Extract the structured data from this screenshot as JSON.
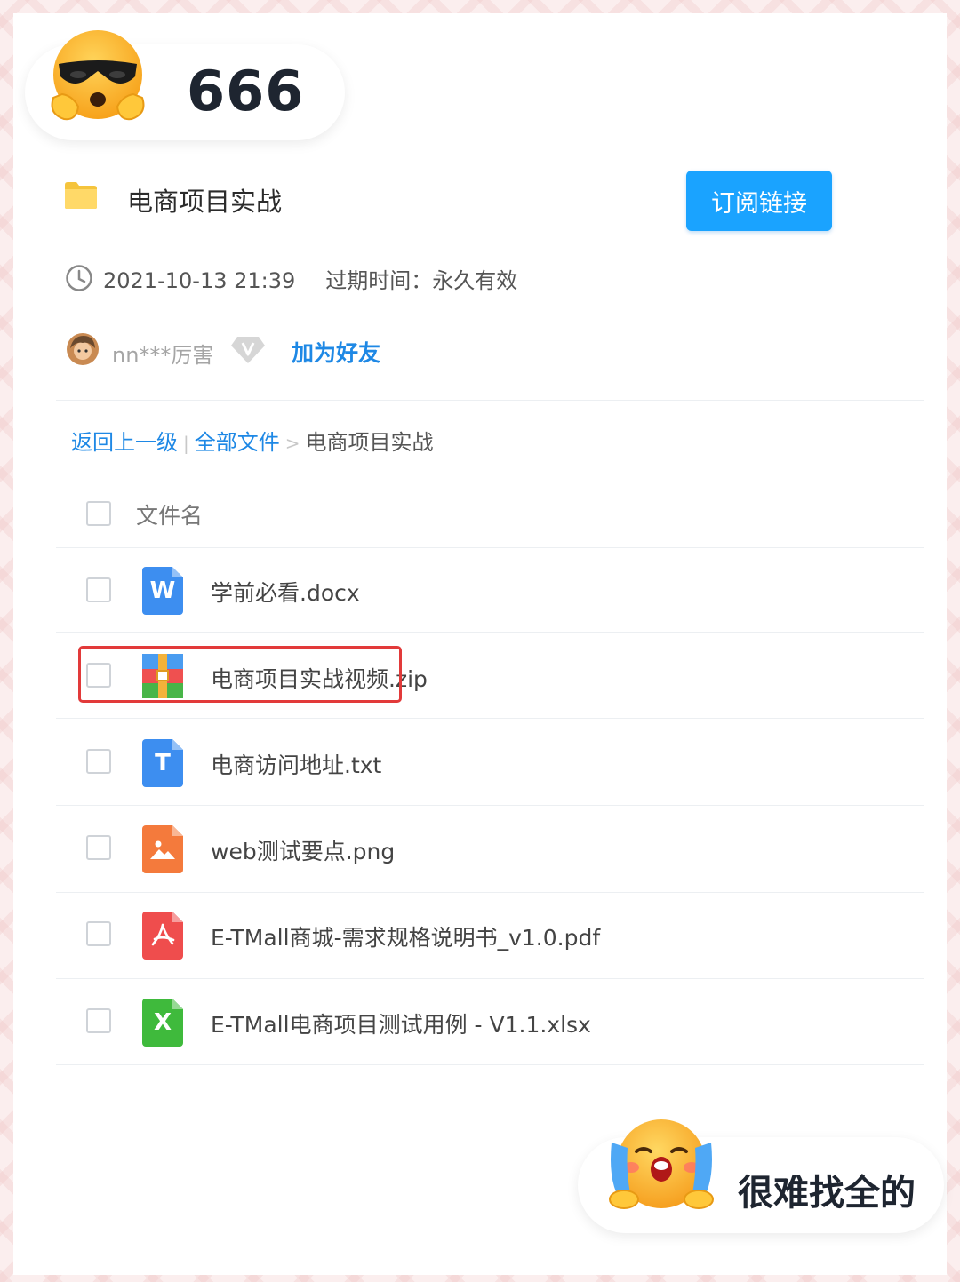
{
  "sticker_top": {
    "text": "666",
    "emoji_icon": "sunglasses-emoji-icon"
  },
  "header": {
    "folder_title": "电商项目实战",
    "subscribe_label": "订阅链接",
    "accent_color": "#1aa3ff"
  },
  "meta": {
    "datetime": "2021-10-13 21:39",
    "expire_label": "过期时间：永久有效"
  },
  "user": {
    "name": "nn***厉害",
    "add_friend_label": "加为好友"
  },
  "breadcrumb": {
    "back_label": "返回上一级",
    "separator": "|",
    "all_files_label": "全部文件",
    "arrow": ">",
    "current": "电商项目实战"
  },
  "list": {
    "column_header": "文件名",
    "files": [
      {
        "name": "学前必看.docx",
        "icon": "word-file-icon",
        "glyph": "W",
        "color": "#3d8ef0"
      },
      {
        "name": "电商项目实战视频.zip",
        "icon": "zip-archive-icon",
        "glyph": "",
        "color": "#f0a030"
      },
      {
        "name": "电商访问地址.txt",
        "icon": "text-file-icon",
        "glyph": "T",
        "color": "#3d8ef0"
      },
      {
        "name": "web测试要点.png",
        "icon": "image-file-icon",
        "glyph": "",
        "color": "#f47a3c"
      },
      {
        "name": "E-TMall商城-需求规格说明书_v1.0.pdf",
        "icon": "pdf-file-icon",
        "glyph": "",
        "color": "#ef4d4d"
      },
      {
        "name": "E-TMall电商项目测试用例 - V1.1.xlsx",
        "icon": "excel-file-icon",
        "glyph": "X",
        "color": "#3fba3c"
      }
    ]
  },
  "sticker_bottom": {
    "text": "很难找全的",
    "emoji_icon": "crying-emoji-icon"
  },
  "highlight_color": "#e23a3a"
}
